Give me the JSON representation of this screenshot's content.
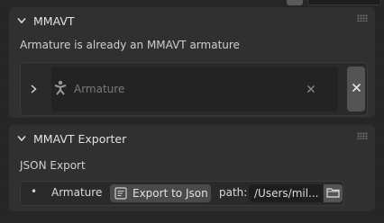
{
  "panels": {
    "mmavt": {
      "title": "MMAVT",
      "message": "Armature is already an MMAVT armature",
      "armature_field": {
        "placeholder": "Armature"
      }
    },
    "exporter": {
      "title": "MMAVT Exporter",
      "section_label": "JSON Export",
      "row": {
        "bullet": "•",
        "name": "Armature",
        "export_button": "Export to Json",
        "path_label": "path:",
        "path_value": "/Users/mil..."
      }
    }
  },
  "icons": {
    "expand": "chevron-down-icon",
    "collapse": "chevron-right-icon",
    "armature": "armature-icon",
    "clear": "clear-x-icon",
    "remove": "close-icon",
    "export": "export-icon",
    "folder": "folder-icon",
    "grip": "drag-grip-icon"
  },
  "colors": {
    "background": "#262626",
    "panel": "#303030",
    "field": "#232323",
    "button": "#4a4a4a",
    "text": "#cfcfcf"
  }
}
